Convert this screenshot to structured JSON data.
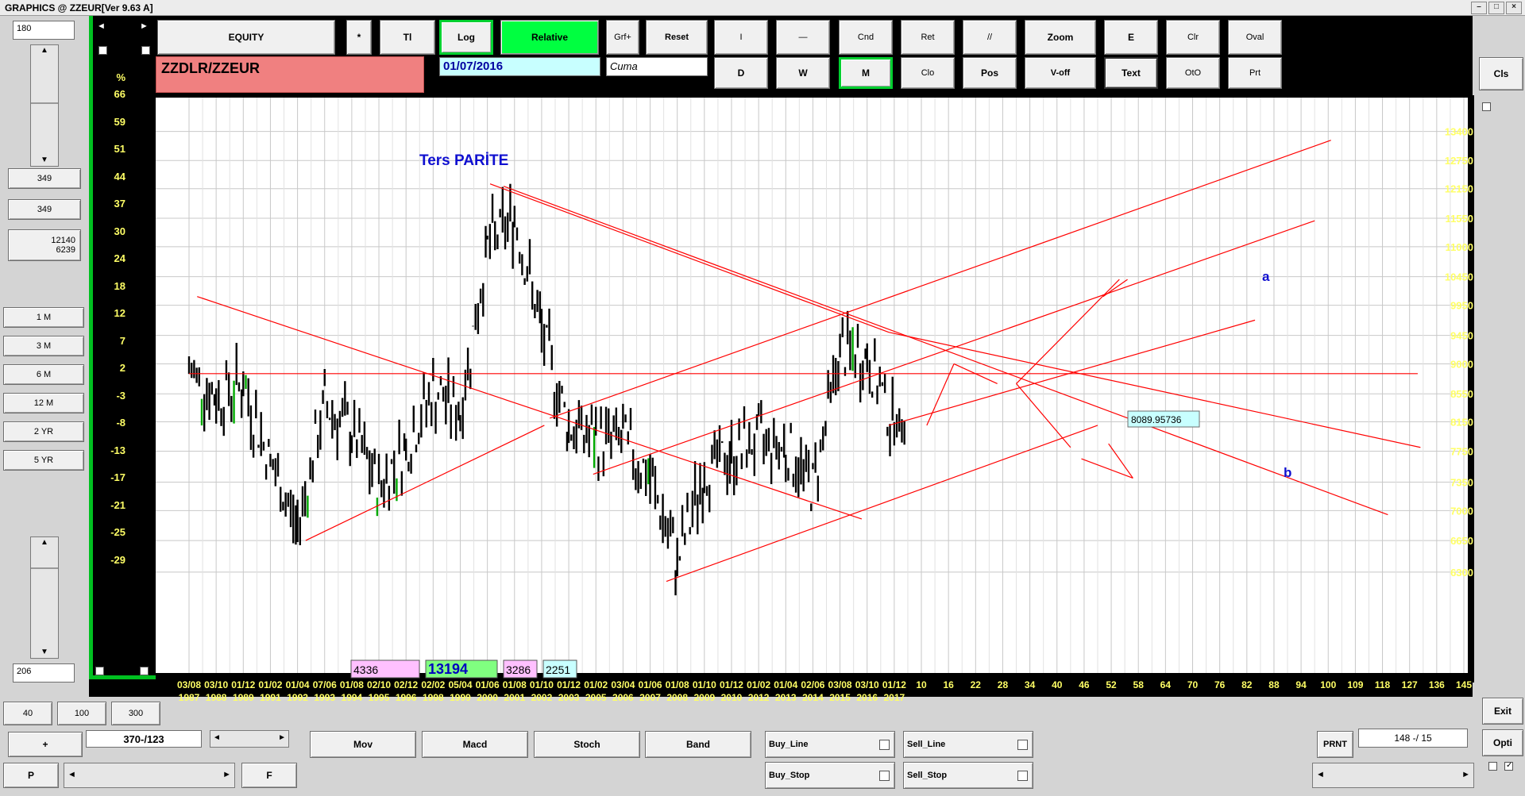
{
  "window": {
    "title": "GRAPHICS  @ ZZEUR[Ver 9.63 A]"
  },
  "left_panel": {
    "top_value": "180",
    "value_a": "349",
    "value_b": "349",
    "range_high": "12140",
    "range_low": "6239",
    "period_buttons": [
      "1 M",
      "3 M",
      "6 M",
      "12 M",
      "2 YR",
      "5 YR"
    ],
    "bottom_value": "206"
  },
  "toolbar": {
    "equity": "EQUITY",
    "star": "*",
    "tl": "Tl",
    "log": "Log",
    "relative": "Relative",
    "grf_plus": "Grf+",
    "reset": "Reset",
    "row1_tools": [
      "I",
      "—",
      "Cnd",
      "Ret",
      "//",
      "Zoom",
      "E",
      "Clr",
      "Oval"
    ],
    "row2_tools": [
      "D",
      "W",
      "M",
      "Clo",
      "Pos",
      "V-off",
      "Text",
      "OtO",
      "Prt"
    ],
    "cls": "Cls"
  },
  "symbol": "ZZDLR/ZZEUR",
  "date": "01/07/2016",
  "day": "Cuma",
  "bottom_bar": {
    "btn_40": "40",
    "btn_100": "100",
    "btn_300": "300",
    "plus": "+",
    "position": "370-/123",
    "p": "P",
    "f": "F",
    "indicators": [
      "Mov",
      "Macd",
      "Stoch",
      "Band"
    ],
    "buy_line": "Buy_Line",
    "sell_line": "Sell_Line",
    "buy_stop": "Buy_Stop",
    "sell_stop": "Sell_Stop",
    "prnt": "PRNT",
    "counter": "148 -/ 15",
    "exit": "Exit",
    "opti": "Opti"
  },
  "colors": {
    "up_bar": "#00aa00",
    "bar": "#000000",
    "trendline": "#ff0000",
    "accent_green": "#00ff40",
    "symbol_bg": "#f08080"
  },
  "chart_data": {
    "type": "bar",
    "scale": "log",
    "annotation_title": "Ters   PARİTE",
    "price_label": "8089.95736",
    "wave_labels": [
      "a",
      "b"
    ],
    "stat_boxes": [
      "4336",
      "13194",
      "3286",
      "2251"
    ],
    "right_axis_ticks": [
      "13400",
      "12750",
      "12150",
      "11550",
      "11000",
      "10450",
      "9950",
      "9450",
      "9000",
      "8550",
      "8150",
      "7750",
      "7350",
      "7000",
      "6650",
      "6300"
    ],
    "left_axis_unit": "%",
    "left_axis_ticks": [
      "66",
      "59",
      "51",
      "44",
      "37",
      "30",
      "24",
      "18",
      "12",
      "7",
      "2",
      "-3",
      "-8",
      "-13",
      "-17",
      "-21",
      "-25",
      "-29"
    ],
    "x_labels": [
      [
        "03/08",
        "1987"
      ],
      [
        "03/10",
        "1988"
      ],
      [
        "01/12",
        "1989"
      ],
      [
        "01/02",
        "1991"
      ],
      [
        "01/04",
        "1992"
      ],
      [
        "07/06",
        "1993"
      ],
      [
        "01/08",
        "1994"
      ],
      [
        "02/10",
        "1995"
      ],
      [
        "02/12",
        "1996"
      ],
      [
        "02/02",
        "1998"
      ],
      [
        "05/04",
        "1999"
      ],
      [
        "01/06",
        "2000"
      ],
      [
        "01/08",
        "2001"
      ],
      [
        "01/10",
        "2002"
      ],
      [
        "01/12",
        "2003"
      ],
      [
        "01/02",
        "2005"
      ],
      [
        "03/04",
        "2006"
      ],
      [
        "01/06",
        "2007"
      ],
      [
        "01/08",
        "2008"
      ],
      [
        "01/10",
        "2009"
      ],
      [
        "01/12",
        "2010"
      ],
      [
        "01/02",
        "2012"
      ],
      [
        "01/04",
        "2013"
      ],
      [
        "02/06",
        "2014"
      ],
      [
        "03/08",
        "2015"
      ],
      [
        "03/10",
        "2016"
      ],
      [
        "01/12",
        "2017"
      ],
      [
        "10",
        ""
      ],
      [
        "16",
        ""
      ],
      [
        "22",
        ""
      ],
      [
        "28",
        ""
      ],
      [
        "34",
        ""
      ],
      [
        "40",
        ""
      ],
      [
        "46",
        ""
      ],
      [
        "52",
        ""
      ],
      [
        "58",
        ""
      ],
      [
        "64",
        ""
      ],
      [
        "70",
        ""
      ],
      [
        "76",
        ""
      ],
      [
        "82",
        ""
      ],
      [
        "88",
        ""
      ],
      [
        "94",
        ""
      ],
      [
        "100",
        ""
      ],
      [
        "109",
        ""
      ],
      [
        "118",
        ""
      ],
      [
        "127",
        ""
      ],
      [
        "136",
        ""
      ],
      [
        "145",
        ""
      ]
    ],
    "series": [
      {
        "x_index": [
          0,
          1,
          2,
          3,
          4,
          5,
          6,
          7,
          8,
          9,
          10,
          11,
          12,
          13,
          14,
          15,
          16,
          17,
          18,
          19,
          20,
          21,
          22,
          23,
          24,
          25,
          26
        ],
        "values": [
          8900,
          8500,
          8700,
          7600,
          6800,
          8400,
          8000,
          7300,
          7800,
          8600,
          8300,
          11000,
          11600,
          9500,
          8100,
          7900,
          7900,
          7400,
          6400,
          7500,
          7700,
          7900,
          7800,
          7300,
          9200,
          9100,
          8100
        ]
      }
    ],
    "trendlines": [
      {
        "from": [
          0.3,
          10100
        ],
        "to": [
          24.8,
          6900
        ]
      },
      {
        "from": [
          4.3,
          6650
        ],
        "to": [
          13.1,
          8100
        ]
      },
      {
        "from": [
          11.1,
          12250
        ],
        "to": [
          25.8,
          9500
        ]
      },
      {
        "from": [
          11.6,
          12200
        ],
        "to": [
          44.2,
          6950
        ]
      },
      {
        "from": [
          13.3,
          8200
        ],
        "to": [
          42.1,
          13200
        ]
      },
      {
        "from": [
          14.9,
          7450
        ],
        "to": [
          41.5,
          11500
        ]
      },
      {
        "from": [
          17.6,
          6200
        ],
        "to": [
          33.5,
          8100
        ]
      },
      {
        "from": [
          25.8,
          8100
        ],
        "to": [
          39.3,
          9700
        ]
      },
      {
        "from": [
          25.8,
          9500
        ],
        "to": [
          45.4,
          7800
        ]
      },
      {
        "from": [
          0,
          8850
        ],
        "to": [
          45.3,
          8850
        ]
      },
      {
        "from": [
          27.2,
          8100
        ],
        "to": [
          28.2,
          9000
        ]
      },
      {
        "from": [
          28.2,
          9000
        ],
        "to": [
          29.8,
          8700
        ]
      },
      {
        "from": [
          30.5,
          8700
        ],
        "to": [
          34.3,
          10400
        ]
      },
      {
        "from": [
          30.5,
          8700
        ],
        "to": [
          32.5,
          7800
        ]
      },
      {
        "from": [
          33.7,
          10100
        ],
        "to": [
          34.6,
          10400
        ]
      },
      {
        "from": [
          32.9,
          7650
        ],
        "to": [
          34.8,
          7400
        ]
      },
      {
        "from": [
          34.8,
          7400
        ],
        "to": [
          33.9,
          7850
        ]
      }
    ]
  }
}
